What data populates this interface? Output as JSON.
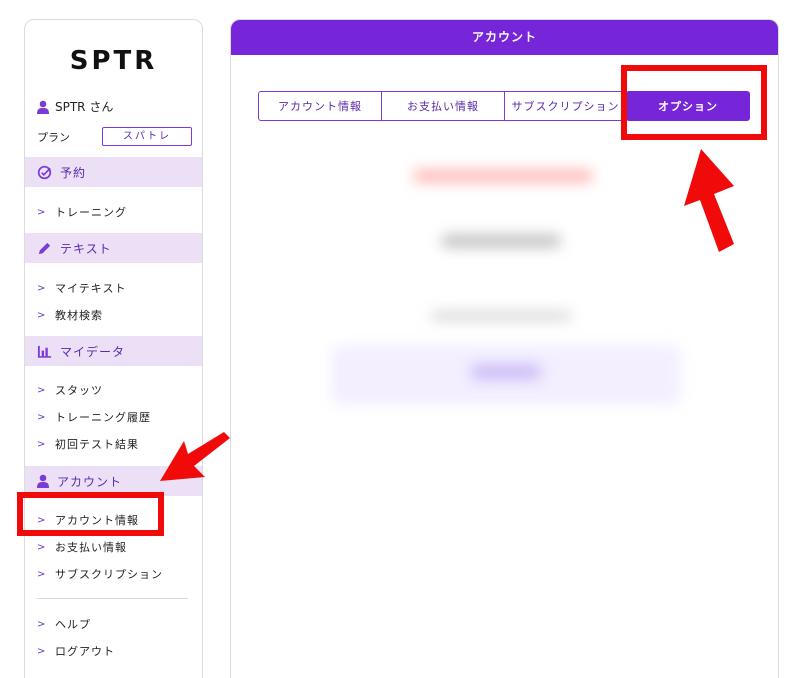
{
  "brand": {
    "logo": "SPTR"
  },
  "user": {
    "name": "SPTR さん"
  },
  "plan": {
    "label": "プラン",
    "value": "スパトレ"
  },
  "sidebar": {
    "sections": [
      {
        "title": "予約",
        "icon": "check-circle-icon",
        "items": [
          "トレーニング"
        ]
      },
      {
        "title": "テキスト",
        "icon": "pencil-icon",
        "items": [
          "マイテキスト",
          "教材検索"
        ]
      },
      {
        "title": "マイデータ",
        "icon": "bar-chart-icon",
        "items": [
          "スタッツ",
          "トレーニング履歴",
          "初回テスト結果"
        ]
      },
      {
        "title": "アカウント",
        "icon": "user-icon",
        "items": [
          "アカウント情報",
          "お支払い情報",
          "サブスクリプション"
        ]
      }
    ],
    "footer_items": [
      "ヘルプ",
      "ログアウト"
    ]
  },
  "main": {
    "header": "アカウント",
    "tabs": [
      {
        "label": "アカウント情報",
        "active": false
      },
      {
        "label": "お支払い情報",
        "active": false
      },
      {
        "label": "サブスクリプション",
        "active": false
      },
      {
        "label": "オプション",
        "active": true
      }
    ]
  },
  "colors": {
    "accent": "#7725d9",
    "section_bg": "#ece0f6",
    "annotation": "#f00a0a"
  }
}
